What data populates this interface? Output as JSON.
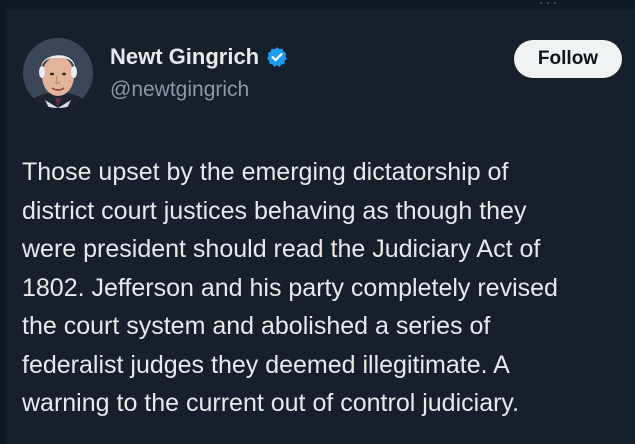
{
  "header": {
    "overflow_glyph": "···"
  },
  "author": {
    "display_name": "Newt Gingrich",
    "handle": "@newtgingrich",
    "verified": true,
    "avatar_icon": "avatar-photo"
  },
  "actions": {
    "follow_label": "Follow"
  },
  "tweet": {
    "lines": [
      "Those upset by the emerging dictatorship of",
      "district court justices behaving as though they",
      "were president should read the Judiciary Act of",
      "1802. Jefferson and his party completely revised",
      "the court system and abolished a series of",
      "federalist judges they deemed illegitimate. A",
      "warning to the current out of control judiciary."
    ]
  },
  "colors": {
    "background": "#15202b",
    "text_primary": "#e7e9ea",
    "text_secondary": "#8b98a5",
    "verified_blue": "#1d9bf0",
    "button_bg": "#eff3f4"
  }
}
